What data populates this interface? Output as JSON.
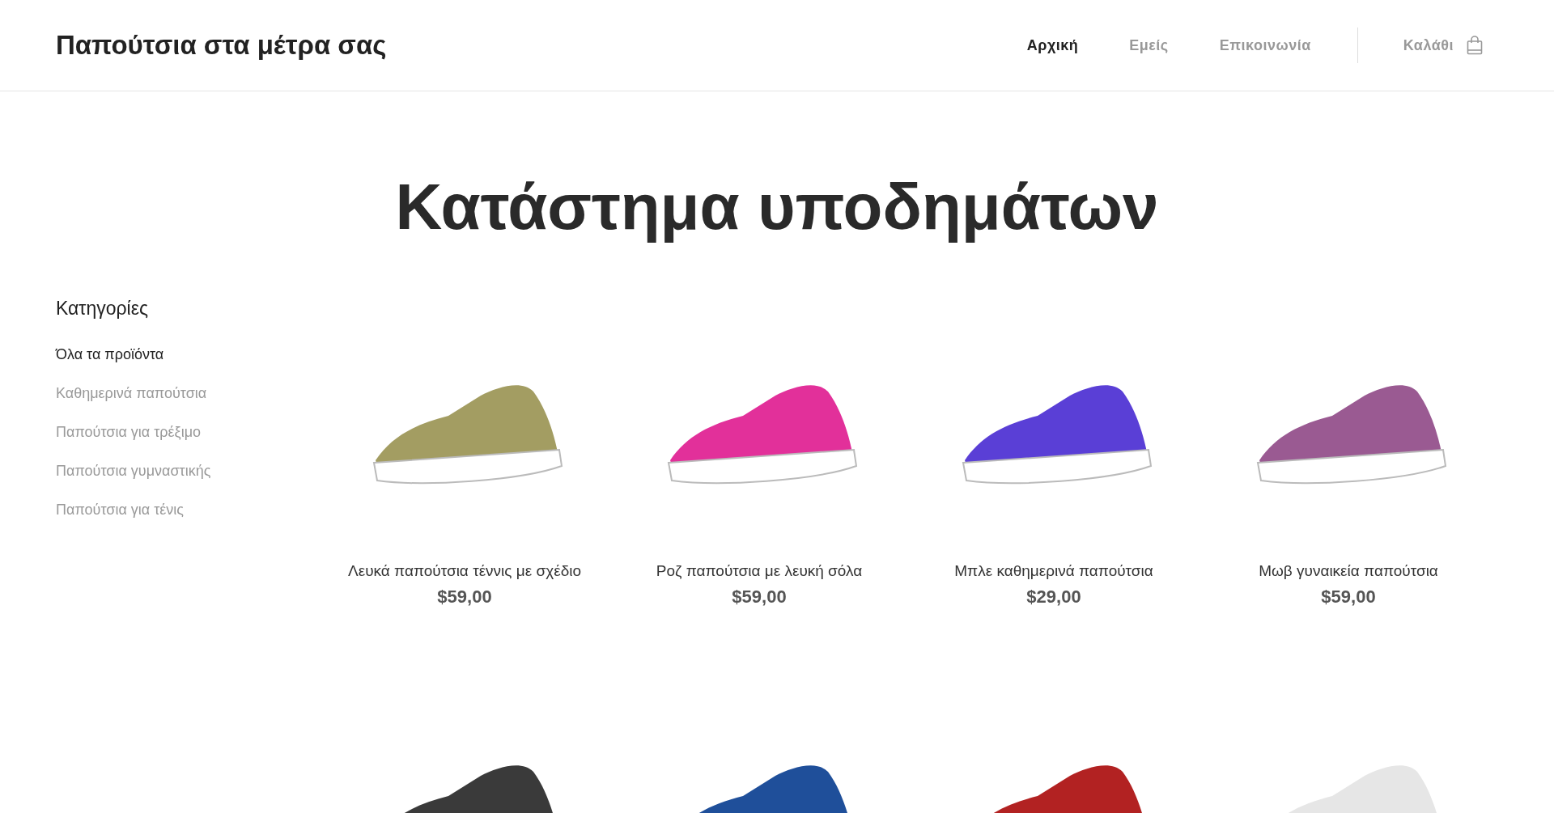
{
  "brand": "Παπούτσια στα μέτρα σας",
  "nav": [
    {
      "label": "Αρχική",
      "selected": true
    },
    {
      "label": "Εμείς",
      "selected": false
    },
    {
      "label": "Επικοινωνία",
      "selected": false
    }
  ],
  "cart": {
    "label": "Καλάθι"
  },
  "heading": "Κατάστημα υποδημάτων",
  "sidebar": {
    "title": "Κατηγορίες",
    "items": [
      {
        "label": "Όλα τα προϊόντα",
        "selected": true
      },
      {
        "label": "Καθημερινά παπούτσια",
        "selected": false
      },
      {
        "label": "Παπούτσια για τρέξιμο",
        "selected": false
      },
      {
        "label": "Παπούτσια γυμναστικής",
        "selected": false
      },
      {
        "label": "Παπούτσια για τένις",
        "selected": false
      }
    ]
  },
  "products": [
    {
      "name": "Λευκά παπούτσια τέννις με σχέδιο",
      "price": "$59,00",
      "color": "#a39d62"
    },
    {
      "name": "Ροζ παπούτσια με λευκή σόλα",
      "price": "$59,00",
      "color": "#e2309a"
    },
    {
      "name": "Μπλε καθημερινά παπούτσια",
      "price": "$29,00",
      "color": "#5a3fd6"
    },
    {
      "name": "Μωβ γυναικεία παπούτσια",
      "price": "$59,00",
      "color": "#9a5a92"
    },
    {
      "color": "#3a3a3a"
    },
    {
      "color": "#1f4f9a"
    },
    {
      "color": "#b22222"
    },
    {
      "color": "#e6e6e6"
    }
  ]
}
